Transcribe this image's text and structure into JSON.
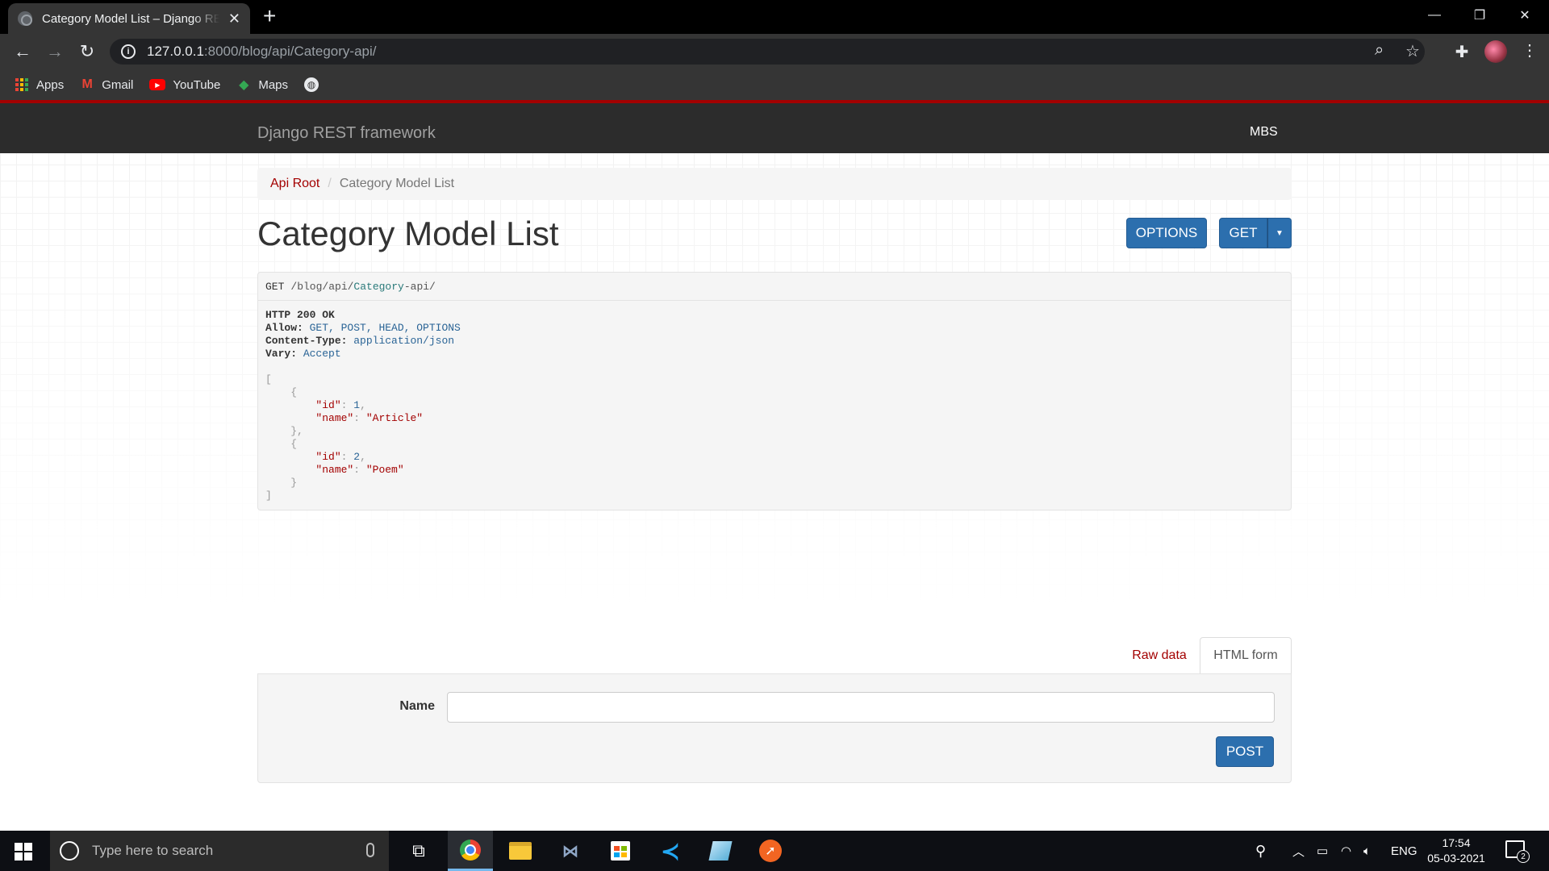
{
  "browser": {
    "tab_title": "Category Model List – Django REST framework",
    "tab_close": "✕",
    "new_tab": "+",
    "window_controls": {
      "minimize": "—",
      "restore": "❐",
      "close": "✕"
    },
    "url_host": "127.0.0.1",
    "url_rest": ":8000/blog/api/Category-api/",
    "nav": {
      "back": "←",
      "forward": "→",
      "reload": "↻"
    },
    "bookmarks": [
      {
        "label": "Apps",
        "icon": "apps-grid-icon"
      },
      {
        "label": "Gmail",
        "icon": "gmail-icon"
      },
      {
        "label": "YouTube",
        "icon": "youtube-icon"
      },
      {
        "label": "Maps",
        "icon": "maps-icon"
      }
    ]
  },
  "drf": {
    "brand": "Django REST framework",
    "user": "MBS",
    "breadcrumb": {
      "root": "Api Root",
      "separator": "/",
      "current": "Category Model List"
    },
    "title": "Category Model List",
    "buttons": {
      "options": "OPTIONS",
      "get": "GET",
      "post": "POST"
    },
    "request": {
      "method": "GET",
      "path_prefix": "/blog/api/",
      "path_name": "Category",
      "path_suffix": "-api/"
    },
    "response": {
      "status": "HTTP 200 OK",
      "headers": [
        {
          "key": "Allow:",
          "value": "GET, POST, HEAD, OPTIONS"
        },
        {
          "key": "Content-Type:",
          "value": "application/json"
        },
        {
          "key": "Vary:",
          "value": "Accept"
        }
      ],
      "items": [
        {
          "id": "1",
          "name": "\"Article\""
        },
        {
          "id": "2",
          "name": "\"Poem\""
        }
      ]
    },
    "form_tabs": {
      "raw": "Raw data",
      "html": "HTML form"
    },
    "form": {
      "name_label": "Name",
      "name_value": ""
    }
  },
  "taskbar": {
    "search_placeholder": "Type here to search",
    "lang": "ENG",
    "time": "17:54",
    "date": "05-03-2021",
    "notification_count": "2"
  },
  "colors": {
    "accent": "#a30000",
    "button": "#2c6fae",
    "navbar": "#2c2c2c"
  }
}
